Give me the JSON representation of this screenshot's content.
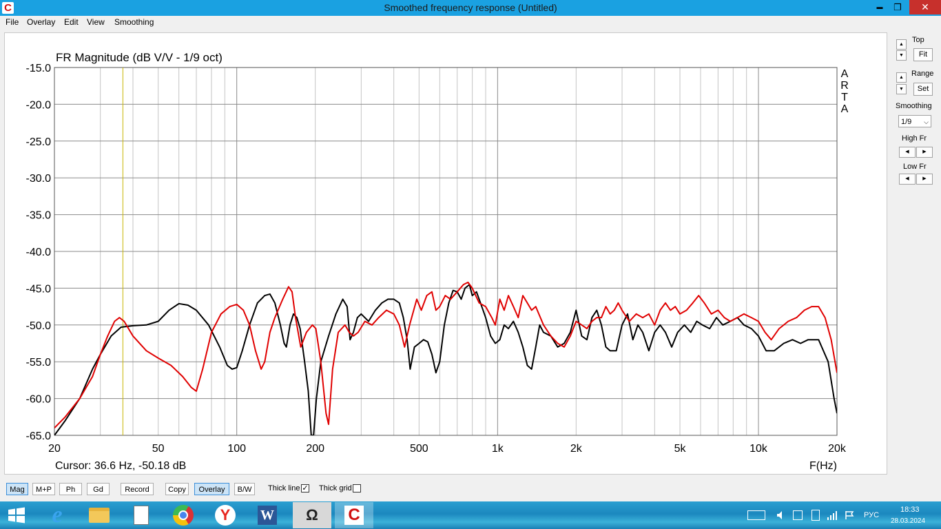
{
  "window": {
    "title": "Smoothed frequency response (Untitled)",
    "app_icon": "arta-icon",
    "min_glyph": "▬",
    "max_glyph": "❐",
    "close_glyph": "✕"
  },
  "menu": [
    "File",
    "Overlay",
    "Edit",
    "View",
    "Smoothing"
  ],
  "chart_data": {
    "type": "line",
    "title": "FR Magnitude (dB V/V - 1/9 oct)",
    "watermark": [
      "A",
      "R",
      "T",
      "A"
    ],
    "xlabel": "F(Hz)",
    "ylabel": "",
    "x_scale": "log",
    "xlim": [
      20,
      20000
    ],
    "ylim": [
      -65,
      -15
    ],
    "grid": true,
    "x_ticks": [
      {
        "value": 20,
        "label": "20"
      },
      {
        "value": 50,
        "label": "50"
      },
      {
        "value": 100,
        "label": "100"
      },
      {
        "value": 200,
        "label": "200"
      },
      {
        "value": 500,
        "label": "500"
      },
      {
        "value": 1000,
        "label": "1k"
      },
      {
        "value": 2000,
        "label": "2k"
      },
      {
        "value": 5000,
        "label": "5k"
      },
      {
        "value": 10000,
        "label": "10k"
      },
      {
        "value": 20000,
        "label": "20k"
      }
    ],
    "y_ticks": [
      {
        "value": -15,
        "label": "-15.0"
      },
      {
        "value": -20,
        "label": "-20.0"
      },
      {
        "value": -25,
        "label": "-25.0"
      },
      {
        "value": -30,
        "label": "-30.0"
      },
      {
        "value": -35,
        "label": "-35.0"
      },
      {
        "value": -40,
        "label": "-40.0"
      },
      {
        "value": -45,
        "label": "-45.0"
      },
      {
        "value": -50,
        "label": "-50.0"
      },
      {
        "value": -55,
        "label": "-55.0"
      },
      {
        "value": -60,
        "label": "-60.0"
      },
      {
        "value": -65,
        "label": "-65.0"
      }
    ],
    "cursor": {
      "freq": 36.6,
      "text": "Cursor: 36.6 Hz, -50.18 dB",
      "color": "#c8b400"
    },
    "series": [
      {
        "color": "#000000",
        "points": [
          [
            20,
            -65
          ],
          [
            22,
            -63
          ],
          [
            25,
            -60
          ],
          [
            28,
            -56
          ],
          [
            30,
            -54
          ],
          [
            33,
            -51.5
          ],
          [
            36,
            -50.3
          ],
          [
            40,
            -50.1
          ],
          [
            45,
            -50
          ],
          [
            50,
            -49.5
          ],
          [
            55,
            -48
          ],
          [
            60,
            -47.1
          ],
          [
            65,
            -47.3
          ],
          [
            70,
            -48
          ],
          [
            78,
            -50
          ],
          [
            86,
            -53
          ],
          [
            92,
            -55.5
          ],
          [
            96,
            -56
          ],
          [
            100,
            -55.8
          ],
          [
            105,
            -53.5
          ],
          [
            112,
            -50
          ],
          [
            120,
            -47
          ],
          [
            128,
            -46
          ],
          [
            134,
            -45.8
          ],
          [
            140,
            -47
          ],
          [
            147,
            -50
          ],
          [
            152,
            -52.5
          ],
          [
            155,
            -53
          ],
          [
            160,
            -50
          ],
          [
            165,
            -48.5
          ],
          [
            170,
            -49
          ],
          [
            175,
            -50.5
          ],
          [
            182,
            -55
          ],
          [
            188,
            -59
          ],
          [
            193,
            -65
          ],
          [
            197,
            -65
          ],
          [
            202,
            -60
          ],
          [
            210,
            -55
          ],
          [
            225,
            -51.5
          ],
          [
            240,
            -48.5
          ],
          [
            255,
            -46.5
          ],
          [
            265,
            -47.5
          ],
          [
            272,
            -52
          ],
          [
            280,
            -51
          ],
          [
            290,
            -49
          ],
          [
            300,
            -48.5
          ],
          [
            320,
            -49.5
          ],
          [
            340,
            -48
          ],
          [
            360,
            -47
          ],
          [
            380,
            -46.5
          ],
          [
            400,
            -46.5
          ],
          [
            420,
            -47
          ],
          [
            435,
            -49
          ],
          [
            450,
            -52
          ],
          [
            462,
            -56
          ],
          [
            480,
            -53
          ],
          [
            500,
            -52.5
          ],
          [
            520,
            -52
          ],
          [
            540,
            -52.3
          ],
          [
            560,
            -54
          ],
          [
            580,
            -56.5
          ],
          [
            600,
            -55
          ],
          [
            625,
            -50
          ],
          [
            650,
            -47
          ],
          [
            675,
            -45.3
          ],
          [
            700,
            -45.5
          ],
          [
            725,
            -46.5
          ],
          [
            750,
            -45
          ],
          [
            780,
            -44.5
          ],
          [
            800,
            -46
          ],
          [
            830,
            -45.5
          ],
          [
            860,
            -47
          ],
          [
            900,
            -49
          ],
          [
            940,
            -51.5
          ],
          [
            980,
            -52.5
          ],
          [
            1020,
            -52
          ],
          [
            1060,
            -50
          ],
          [
            1100,
            -50.5
          ],
          [
            1150,
            -49.5
          ],
          [
            1200,
            -51
          ],
          [
            1250,
            -53
          ],
          [
            1300,
            -55.5
          ],
          [
            1350,
            -56
          ],
          [
            1400,
            -53
          ],
          [
            1450,
            -50
          ],
          [
            1500,
            -51
          ],
          [
            1600,
            -51.5
          ],
          [
            1700,
            -53
          ],
          [
            1800,
            -52.5
          ],
          [
            1900,
            -51
          ],
          [
            2000,
            -48
          ],
          [
            2100,
            -51.5
          ],
          [
            2200,
            -52
          ],
          [
            2300,
            -49
          ],
          [
            2400,
            -48
          ],
          [
            2500,
            -50
          ],
          [
            2600,
            -53
          ],
          [
            2700,
            -53.5
          ],
          [
            2850,
            -53.5
          ],
          [
            3000,
            -50
          ],
          [
            3150,
            -48.5
          ],
          [
            3300,
            -52
          ],
          [
            3450,
            -50
          ],
          [
            3600,
            -51
          ],
          [
            3800,
            -53.5
          ],
          [
            4000,
            -51
          ],
          [
            4200,
            -50
          ],
          [
            4400,
            -51
          ],
          [
            4650,
            -53
          ],
          [
            4900,
            -51
          ],
          [
            5200,
            -50
          ],
          [
            5500,
            -51
          ],
          [
            5800,
            -49.5
          ],
          [
            6100,
            -50
          ],
          [
            6500,
            -50.5
          ],
          [
            6900,
            -49
          ],
          [
            7300,
            -50
          ],
          [
            7800,
            -49.5
          ],
          [
            8300,
            -49
          ],
          [
            8800,
            -50
          ],
          [
            9400,
            -50.5
          ],
          [
            10000,
            -51.5
          ],
          [
            10700,
            -53.5
          ],
          [
            11500,
            -53.5
          ],
          [
            12500,
            -52.5
          ],
          [
            13500,
            -52
          ],
          [
            14500,
            -52.5
          ],
          [
            15500,
            -52
          ],
          [
            17000,
            -52
          ],
          [
            18500,
            -55
          ],
          [
            19500,
            -60
          ],
          [
            20000,
            -62
          ]
        ]
      },
      {
        "color": "#e00000",
        "points": [
          [
            20,
            -64
          ],
          [
            22,
            -62.5
          ],
          [
            25,
            -60
          ],
          [
            28,
            -57
          ],
          [
            30,
            -54
          ],
          [
            32,
            -51.5
          ],
          [
            34,
            -49.5
          ],
          [
            35.5,
            -49
          ],
          [
            37,
            -49.5
          ],
          [
            40,
            -51.5
          ],
          [
            45,
            -53.5
          ],
          [
            50,
            -54.5
          ],
          [
            56,
            -55.5
          ],
          [
            62,
            -57
          ],
          [
            67,
            -58.5
          ],
          [
            70,
            -59
          ],
          [
            74,
            -56
          ],
          [
            80,
            -51
          ],
          [
            87,
            -48.5
          ],
          [
            94,
            -47.5
          ],
          [
            100,
            -47.2
          ],
          [
            106,
            -48
          ],
          [
            112,
            -50
          ],
          [
            118,
            -53.5
          ],
          [
            124,
            -56
          ],
          [
            128,
            -55
          ],
          [
            134,
            -51
          ],
          [
            140,
            -49
          ],
          [
            150,
            -46.5
          ],
          [
            158,
            -44.8
          ],
          [
            163,
            -45.5
          ],
          [
            168,
            -49
          ],
          [
            176,
            -53
          ],
          [
            185,
            -51
          ],
          [
            195,
            -50
          ],
          [
            201,
            -50.5
          ],
          [
            210,
            -55
          ],
          [
            220,
            -62
          ],
          [
            225,
            -63.5
          ],
          [
            233,
            -56
          ],
          [
            245,
            -51
          ],
          [
            260,
            -50
          ],
          [
            270,
            -51
          ],
          [
            280,
            -51.5
          ],
          [
            292,
            -51
          ],
          [
            310,
            -49.5
          ],
          [
            330,
            -50
          ],
          [
            350,
            -49
          ],
          [
            375,
            -48
          ],
          [
            400,
            -48.5
          ],
          [
            420,
            -50
          ],
          [
            440,
            -53
          ],
          [
            460,
            -50
          ],
          [
            490,
            -46.5
          ],
          [
            510,
            -48
          ],
          [
            535,
            -46
          ],
          [
            560,
            -45.5
          ],
          [
            580,
            -48
          ],
          [
            600,
            -47.5
          ],
          [
            630,
            -46
          ],
          [
            660,
            -46.5
          ],
          [
            700,
            -45.5
          ],
          [
            740,
            -44.5
          ],
          [
            770,
            -44.2
          ],
          [
            800,
            -45
          ],
          [
            850,
            -47
          ],
          [
            900,
            -47.5
          ],
          [
            950,
            -49
          ],
          [
            980,
            -50
          ],
          [
            1020,
            -46.5
          ],
          [
            1060,
            -48
          ],
          [
            1100,
            -46
          ],
          [
            1150,
            -47.5
          ],
          [
            1200,
            -49
          ],
          [
            1250,
            -46
          ],
          [
            1300,
            -47
          ],
          [
            1350,
            -48
          ],
          [
            1400,
            -47.5
          ],
          [
            1500,
            -50
          ],
          [
            1600,
            -51.5
          ],
          [
            1700,
            -52.5
          ],
          [
            1800,
            -53
          ],
          [
            1900,
            -51.5
          ],
          [
            2000,
            -49.5
          ],
          [
            2100,
            -50
          ],
          [
            2200,
            -50.5
          ],
          [
            2300,
            -49.5
          ],
          [
            2400,
            -49
          ],
          [
            2500,
            -49
          ],
          [
            2600,
            -47.5
          ],
          [
            2700,
            -48.5
          ],
          [
            2800,
            -48
          ],
          [
            2900,
            -47
          ],
          [
            3000,
            -48
          ],
          [
            3200,
            -49.5
          ],
          [
            3400,
            -48.5
          ],
          [
            3600,
            -49
          ],
          [
            3800,
            -48.5
          ],
          [
            4000,
            -50
          ],
          [
            4200,
            -48
          ],
          [
            4400,
            -47
          ],
          [
            4600,
            -48
          ],
          [
            4800,
            -47.5
          ],
          [
            5000,
            -48.5
          ],
          [
            5300,
            -48
          ],
          [
            5600,
            -47
          ],
          [
            5900,
            -46
          ],
          [
            6200,
            -47
          ],
          [
            6600,
            -48.5
          ],
          [
            7000,
            -48
          ],
          [
            7400,
            -49
          ],
          [
            7800,
            -49.5
          ],
          [
            8300,
            -49
          ],
          [
            8800,
            -48.5
          ],
          [
            9400,
            -49
          ],
          [
            10000,
            -49.5
          ],
          [
            10600,
            -51
          ],
          [
            11200,
            -52
          ],
          [
            12000,
            -50.5
          ],
          [
            13000,
            -49.5
          ],
          [
            14000,
            -49
          ],
          [
            15000,
            -48
          ],
          [
            16000,
            -47.5
          ],
          [
            17000,
            -47.5
          ],
          [
            18000,
            -49
          ],
          [
            19000,
            -52
          ],
          [
            20000,
            -56.5
          ]
        ]
      }
    ]
  },
  "right_panel": {
    "top_label": "Top",
    "fit_label": "Fit",
    "range_label": "Range",
    "set_label": "Set",
    "smoothing_label": "Smoothing",
    "smoothing_value": "1/9",
    "high_fr_label": "High Fr",
    "low_fr_label": "Low Fr",
    "up_glyph": "▲",
    "down_glyph": "▼",
    "left_glyph": "◀",
    "right_glyph": "▶",
    "dropdown_glyph": "⌵"
  },
  "bottom_bar": {
    "mag": "Mag",
    "mp": "M+P",
    "ph": "Ph",
    "gd": "Gd",
    "record": "Record",
    "copy": "Copy",
    "overlay": "Overlay",
    "bw": "B/W",
    "thick_line": "Thick line",
    "thick_line_checked": true,
    "thick_grid": "Thick grid",
    "thick_grid_checked": false,
    "check_glyph": "✓"
  },
  "taskbar": {
    "apps": [
      "ie-icon",
      "file-explorer-icon",
      "document-viewer-icon",
      "chrome-icon",
      "yandex-browser-icon",
      "word-icon",
      "omega-icon",
      "arta-icon"
    ],
    "glyphs": {
      "ie": "e",
      "yandex": "Y",
      "word": "W",
      "omega": "Ω",
      "arta": "C"
    },
    "language": "РУС",
    "time": "18:33",
    "date": "28.03.2024",
    "colors": {
      "chrome_red": "#db3236",
      "chrome_green": "#3cba54",
      "chrome_yellow": "#f4c20d",
      "chrome_blue": "#4885ed"
    }
  }
}
